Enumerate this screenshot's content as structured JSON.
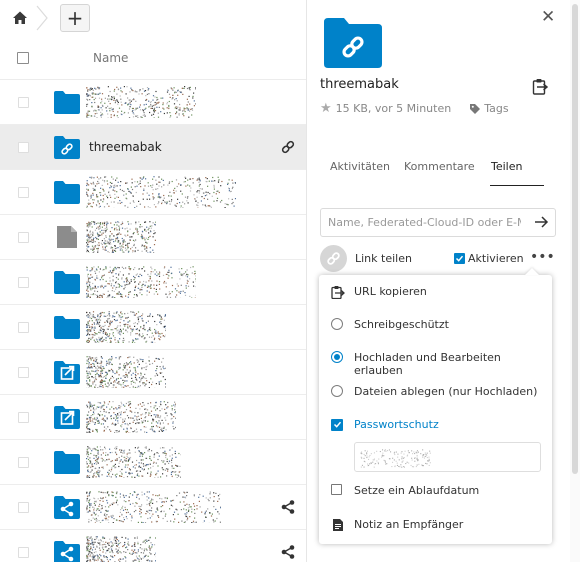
{
  "toolbar": {
    "add_label": "+"
  },
  "file_list": {
    "header": {
      "name_label": "Name"
    },
    "rows": [
      {
        "icon": "folder-icon",
        "name": "",
        "action": ""
      },
      {
        "icon": "folder-link-icon",
        "name": "threemabak",
        "action": "link-icon",
        "selected": true
      },
      {
        "icon": "folder-icon",
        "name": "",
        "action": ""
      },
      {
        "icon": "file-icon",
        "name": "",
        "action": ""
      },
      {
        "icon": "folder-icon",
        "name": "",
        "action": ""
      },
      {
        "icon": "folder-icon",
        "name": "",
        "action": ""
      },
      {
        "icon": "folder-external-icon",
        "name": "",
        "action": ""
      },
      {
        "icon": "folder-external-icon",
        "name": "",
        "action": ""
      },
      {
        "icon": "folder-icon",
        "name": "",
        "action": ""
      },
      {
        "icon": "folder-shared-icon",
        "name": "",
        "action": "share-icon"
      },
      {
        "icon": "folder-shared-icon",
        "name": "",
        "action": "share-icon"
      }
    ]
  },
  "sidebar": {
    "title": "threemabak",
    "size_time": "15 KB, vor 5 Minuten",
    "tags_label": "Tags",
    "tabs": [
      {
        "label": "Aktivitäten"
      },
      {
        "label": "Kommentare"
      },
      {
        "label": "Teilen",
        "active": true
      }
    ],
    "share_placeholder": "Name, Federated-Cloud-ID oder E-M...",
    "link_label": "Link teilen",
    "activate_label": "Aktivieren",
    "more_label": "•••"
  },
  "menu": {
    "items": [
      {
        "label": "URL kopieren",
        "icon": "clipboard-icon"
      },
      {
        "label": "Schreibgeschützt",
        "icon": "radio-icon"
      },
      {
        "label": "Hochladen und Bearbeiten erlauben",
        "icon": "radio-selected-icon",
        "selected": true
      },
      {
        "label": "Dateien ablegen (nur Hochladen)",
        "icon": "radio-icon"
      },
      {
        "label": "Passwortschutz",
        "icon": "checkbox-checked-icon",
        "checked": true
      },
      {
        "label": "Setze ein Ablaufdatum",
        "icon": "checkbox-icon"
      },
      {
        "label": "Notiz an Empfänger",
        "icon": "note-icon"
      }
    ]
  },
  "colors": {
    "accent": "#0082c9",
    "selected_row": "#ececec"
  }
}
